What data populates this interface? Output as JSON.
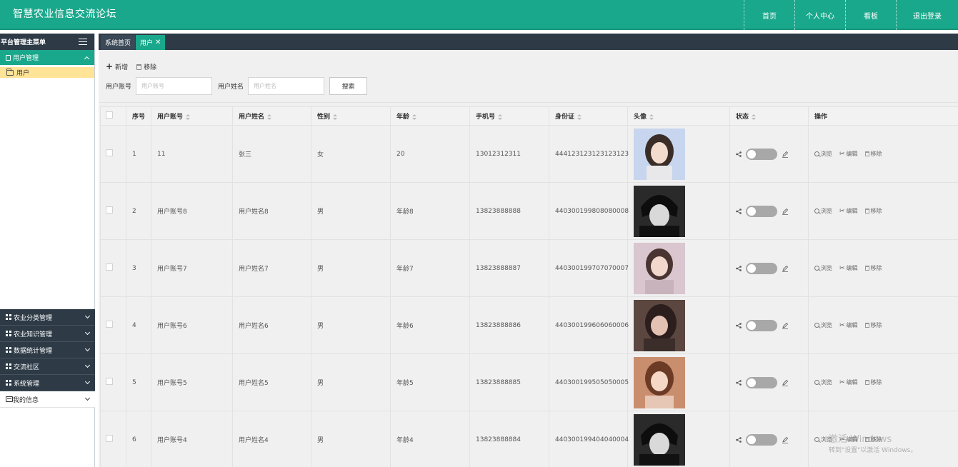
{
  "header": {
    "title": "智慧农业信息交流论坛",
    "nav": [
      "首页",
      "个人中心",
      "看板",
      "退出登录"
    ]
  },
  "sidebar": {
    "title": "平台管理主菜单",
    "active_group": "用户管理",
    "active_sub": "用户",
    "groups": [
      "农业分类管理",
      "农业知识管理",
      "数据统计管理",
      "交流社区",
      "系统管理"
    ],
    "my_info": "我的信息"
  },
  "tabs": [
    {
      "label": "系统首页"
    },
    {
      "label": "用户"
    }
  ],
  "toolbar": {
    "add_label": "新增",
    "remove_label": "移除"
  },
  "search": {
    "account_label": "用户账号",
    "account_placeholder": "用户账号",
    "name_label": "用户姓名",
    "name_placeholder": "用户姓名",
    "button_label": "搜索"
  },
  "table": {
    "headers": [
      "序号",
      "用户账号",
      "用户姓名",
      "性别",
      "年龄",
      "手机号",
      "身份证",
      "头像",
      "状态",
      "操作"
    ],
    "actions": {
      "view": "浏览",
      "edit": "编辑",
      "remove": "移除"
    },
    "rows": [
      {
        "idx": "1",
        "account": "11",
        "name": "张三",
        "gender": "女",
        "age": "20",
        "phone": "13012312311",
        "id_card": "444123123123123123",
        "avatar": "girl-light"
      },
      {
        "idx": "2",
        "account": "用户账号8",
        "name": "用户姓名8",
        "gender": "男",
        "age": "年龄8",
        "phone": "13823888888",
        "id_card": "440300199808080008",
        "avatar": "anime-boy"
      },
      {
        "idx": "3",
        "account": "用户账号7",
        "name": "用户姓名7",
        "gender": "男",
        "age": "年龄7",
        "phone": "13823888887",
        "id_card": "440300199707070007",
        "avatar": "girl-pink"
      },
      {
        "idx": "4",
        "account": "用户账号6",
        "name": "用户姓名6",
        "gender": "男",
        "age": "年龄6",
        "phone": "13823888886",
        "id_card": "440300199606060006",
        "avatar": "girl-dark"
      },
      {
        "idx": "5",
        "account": "用户账号5",
        "name": "用户姓名5",
        "gender": "男",
        "age": "年龄5",
        "phone": "13823888885",
        "id_card": "440300199505050005",
        "avatar": "girl-warm"
      },
      {
        "idx": "6",
        "account": "用户账号4",
        "name": "用户姓名4",
        "gender": "男",
        "age": "年龄4",
        "phone": "13823888884",
        "id_card": "440300199404040004",
        "avatar": "anime-boy"
      }
    ]
  },
  "watermark": {
    "line1": "激活 Windows",
    "line2": "转到\"设置\"以激活 Windows。"
  },
  "colors": {
    "accent": "#1aa88c",
    "dark_nav": "#2e3b47",
    "highlight": "#ffe396"
  }
}
